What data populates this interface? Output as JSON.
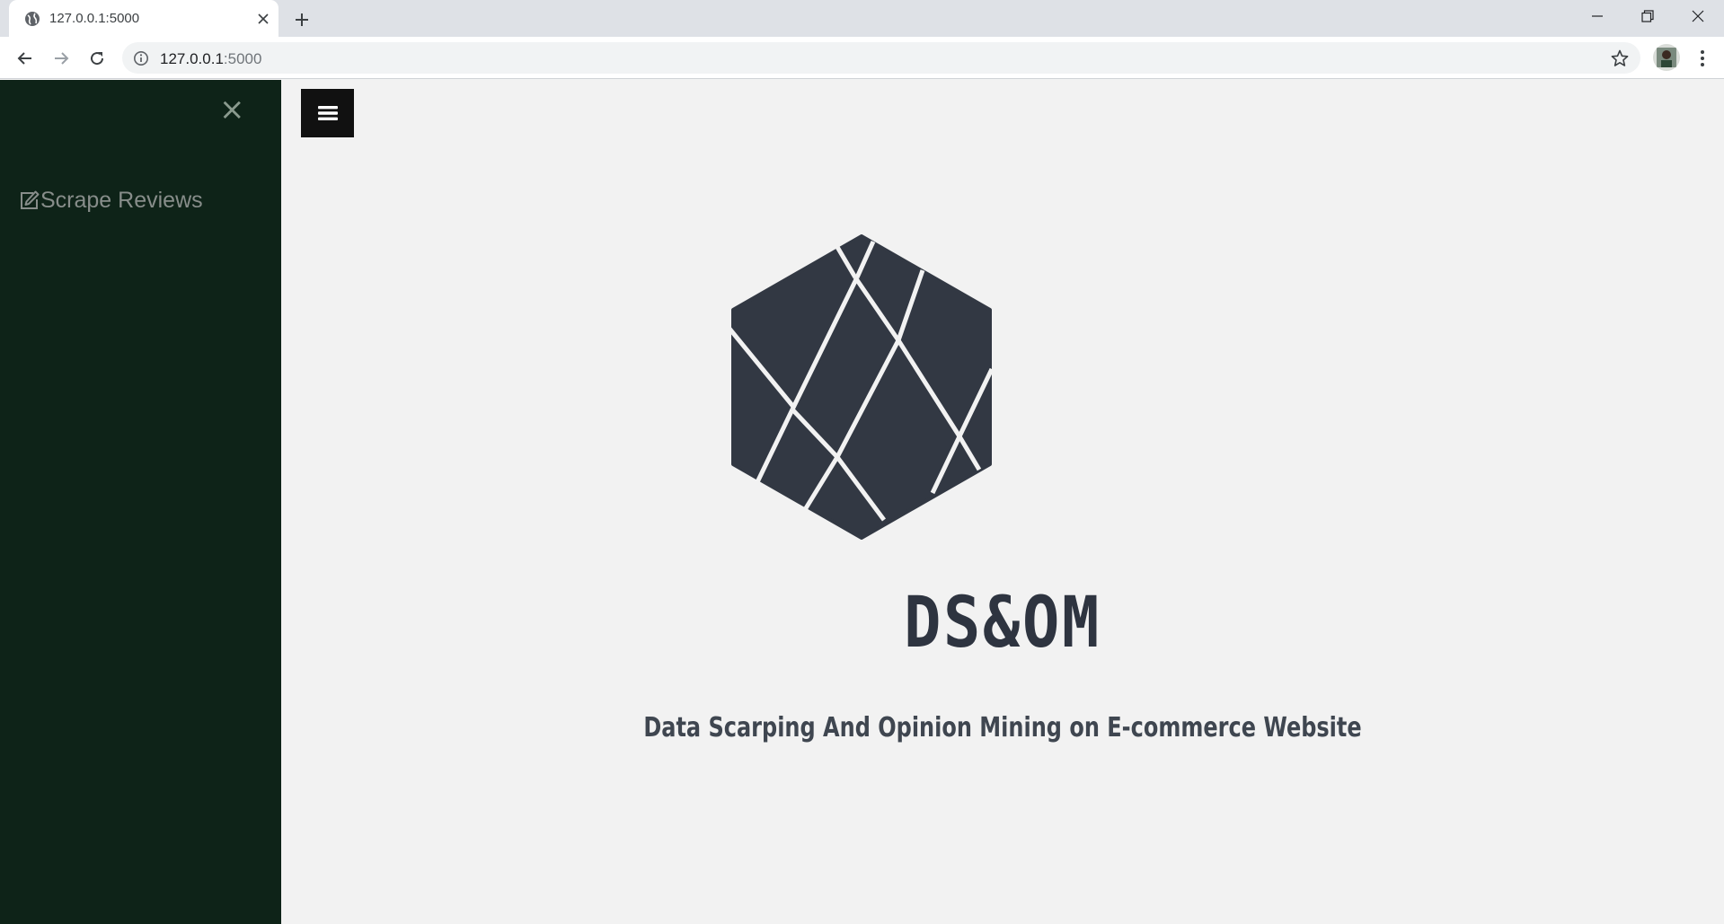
{
  "browser": {
    "tab": {
      "title": "127.0.0.1:5000"
    },
    "address": {
      "host": "127.0.0.1",
      "port": ":5000"
    }
  },
  "sidebar": {
    "close_label": "×",
    "items": [
      {
        "label": "Scrape Reviews",
        "icon": "edit-icon"
      }
    ],
    "colors": {
      "background": "#0e2318",
      "text": "#878d8a"
    }
  },
  "main": {
    "title": "DS&OM",
    "subtitle": "Data Scarping And Opinion Mining on E-commerce Website",
    "colors": {
      "logo": "#323843",
      "title": "#2e3440",
      "background": "#f2f2f2"
    }
  }
}
